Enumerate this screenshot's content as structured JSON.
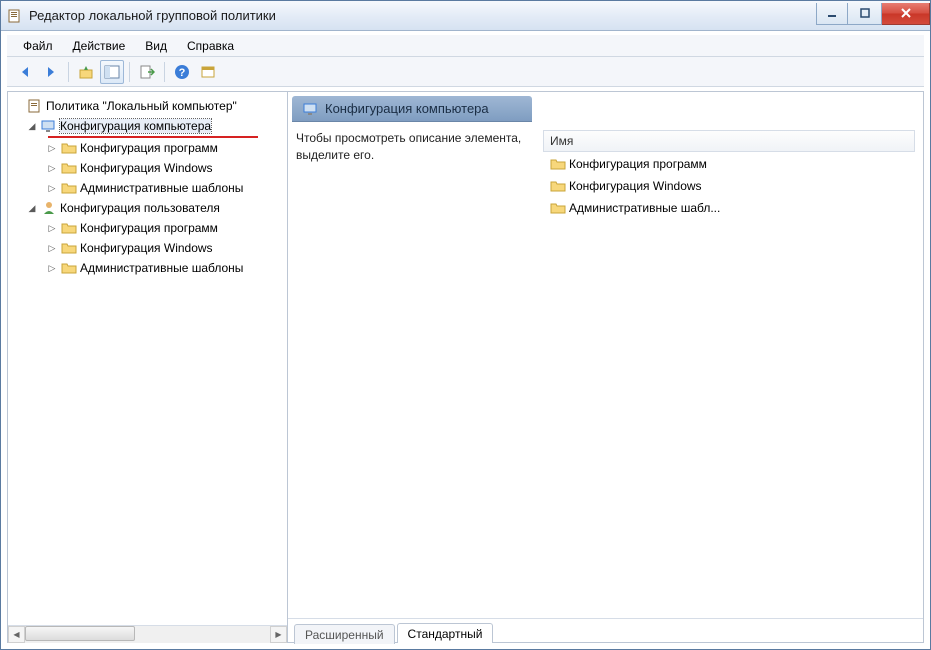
{
  "window": {
    "title": "Редактор локальной групповой политики"
  },
  "menu": {
    "file": "Файл",
    "action": "Действие",
    "view": "Вид",
    "help": "Справка"
  },
  "toolbar_icons": {
    "back": "arrow-left-icon",
    "forward": "arrow-right-icon",
    "up": "folder-up-icon",
    "showhide": "tree-toggle-icon",
    "export": "export-icon",
    "help": "help-icon",
    "props": "properties-icon"
  },
  "tree": {
    "root": "Политика \"Локальный компьютер\"",
    "computer": {
      "label": "Конфигурация компьютера",
      "children": [
        "Конфигурация программ",
        "Конфигурация Windows",
        "Административные шаблоны"
      ]
    },
    "user": {
      "label": "Конфигурация пользователя",
      "children": [
        "Конфигурация программ",
        "Конфигурация Windows",
        "Административные шаблоны"
      ]
    }
  },
  "header": {
    "title": "Конфигурация компьютера"
  },
  "description": "Чтобы просмотреть описание элемента, выделите его.",
  "list": {
    "column": "Имя",
    "items": [
      "Конфигурация программ",
      "Конфигурация Windows",
      "Административные шабл..."
    ]
  },
  "tabs": {
    "extended": "Расширенный",
    "standard": "Стандартный"
  }
}
